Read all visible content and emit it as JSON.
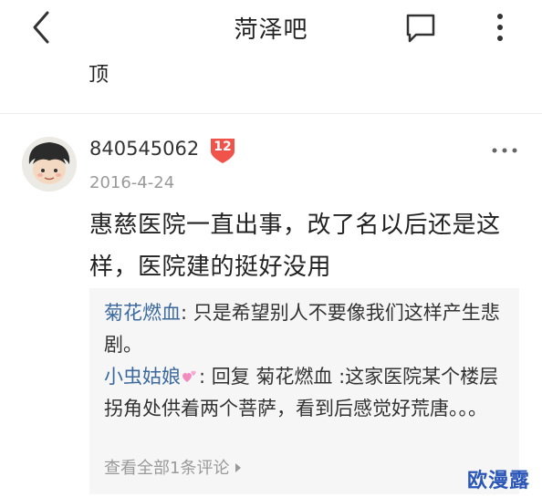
{
  "header": {
    "title": "菏泽吧"
  },
  "previous_post_tail": "顶",
  "post": {
    "username": "840545062",
    "level": "12",
    "date": "2016-4-24",
    "body": "惠慈医院一直出事，改了名以后还是这样，医院建的挺好没用"
  },
  "replies": [
    {
      "name": "菊花燃血",
      "text": ": 只是希望别人不要像我们这样产生悲剧。"
    },
    {
      "name": "小虫姑娘",
      "text": ": 回复 菊花燃血 :这家医院某个楼层拐角处供着两个菩萨，看到后感觉好荒唐。。。"
    }
  ],
  "view_all_label": "查看全部1条评论",
  "watermark": "欧漫露",
  "colors": {
    "reply_name": "#3d6a9e",
    "level_badge": "#f0534a",
    "watermark": "#2a56b8"
  }
}
